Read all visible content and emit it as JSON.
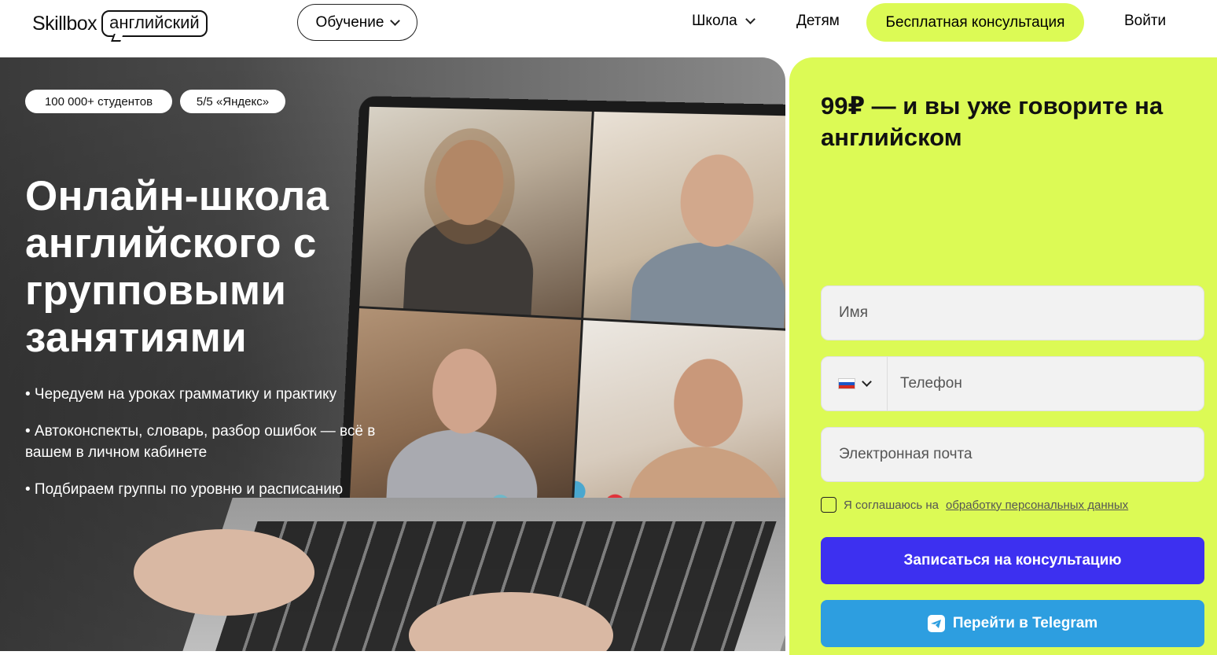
{
  "header": {
    "logo_main": "Skillbox",
    "logo_sub": "английский",
    "menu_label": "Обучение",
    "nav": {
      "school": "Школа",
      "kids": "Детям",
      "consult": "Бесплатная консультация",
      "login": "Войти"
    }
  },
  "hero": {
    "badges": [
      "100 000+ студентов",
      "5/5 «Яндекс»"
    ],
    "title": "Онлайн-школа английского с групповыми занятиями",
    "bullets": [
      "• Чередуем на уроках грамматику и практику",
      "• Автоконспекты, словарь, разбор ошибок — всё в вашем в личном кабинете",
      "• Подбираем группы по уровню и расписанию"
    ]
  },
  "form": {
    "title": "99₽ — и вы уже говорите на английском",
    "name_placeholder": "Имя",
    "phone_placeholder": "Телефон",
    "email_placeholder": "Электронная почта",
    "agree_text": "Я соглашаюсь на",
    "agree_link": "обработку персональных данных",
    "submit_label": "Записаться на консультацию",
    "telegram_label": "Перейти в Telegram"
  },
  "colors": {
    "accent_lime": "#dcfa55",
    "submit_blue": "#3d30f0",
    "telegram_blue": "#2d9ee0"
  }
}
